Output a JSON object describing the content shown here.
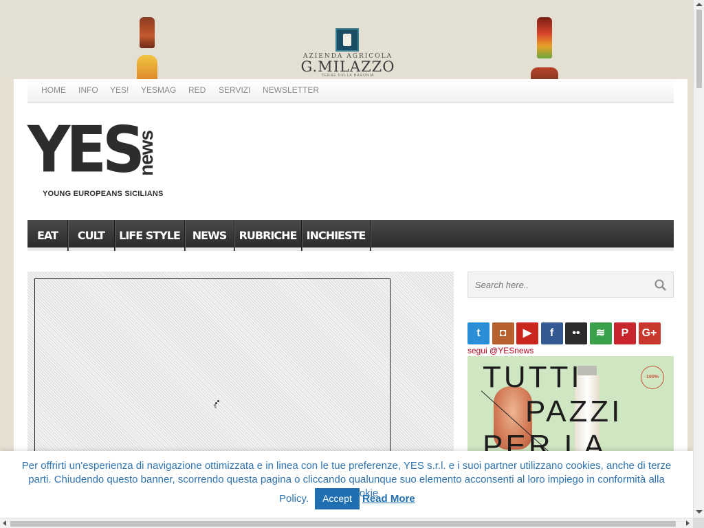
{
  "banner": {
    "brand_line1": "AZIENDA AGRICOLA",
    "brand_name": "G.MILAZZO",
    "brand_line2": "TERRE DELLA BARONIA"
  },
  "topnav": {
    "items": [
      "HOME",
      "INFO",
      "YES!",
      "YESMAG",
      "RED",
      "SERVIZI",
      "NEWSLETTER"
    ]
  },
  "logo": {
    "mark": "YES",
    "news": "news",
    "tagline": "YOUNG EUROPEANS SICILIANS"
  },
  "mainnav": {
    "items": [
      "EAT",
      "CULT",
      "LIFE STYLE",
      "NEWS",
      "RUBRICHE",
      "INCHIESTE"
    ]
  },
  "search": {
    "placeholder": "Search here.."
  },
  "social": {
    "icons": [
      {
        "name": "twitter-icon",
        "glyph": "t",
        "color": "#2a8fd6"
      },
      {
        "name": "instagram-icon",
        "glyph": "◘",
        "color": "#b6612e"
      },
      {
        "name": "youtube-icon",
        "glyph": "▶",
        "color": "#c8261e"
      },
      {
        "name": "facebook-icon",
        "glyph": "f",
        "color": "#345a94"
      },
      {
        "name": "flickr-icon",
        "glyph": "••",
        "color": "#2c2c2c"
      },
      {
        "name": "spotify-icon",
        "glyph": "≋",
        "color": "#3aa04a"
      },
      {
        "name": "pinterest-icon",
        "glyph": "P",
        "color": "#c8262c"
      },
      {
        "name": "googleplus-icon",
        "glyph": "G+",
        "color": "#c8382e"
      }
    ],
    "follow_text": "segui @YESnews"
  },
  "sidebar_ad": {
    "line1": "TUTTI",
    "line2": "PAZZI",
    "line3": "PER LA",
    "badge": "100%"
  },
  "cookie": {
    "message": "Per offrirti un'esperienza di navigazione ottimizzata e in linea con le tue preferenze, YES s.r.l. e i suoi partner utilizzano cookies, anche di terze parti. Chiudendo questo banner, scorrendo questa pagina o cliccando qualunque suo elemento acconsenti al loro impiego in conformità alla nostra Cookie",
    "policy": "Policy.",
    "accept": "Accept",
    "read_more": "Read More"
  }
}
